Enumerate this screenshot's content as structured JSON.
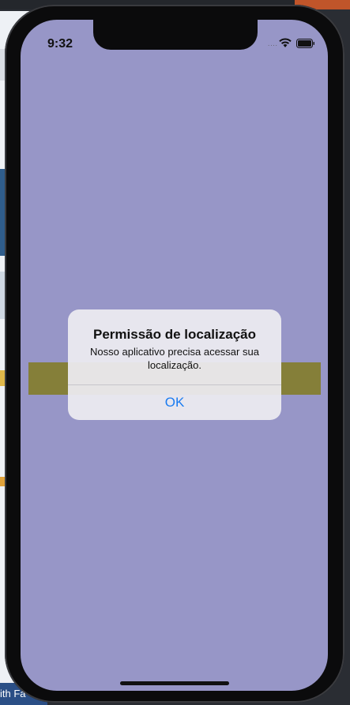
{
  "status_bar": {
    "time": "9:32",
    "signal_dots": "....",
    "icons": [
      "wifi-icon",
      "battery-icon"
    ]
  },
  "alert": {
    "title": "Permissão de localização",
    "message": "Nosso aplicativo precisa acessar sua localização.",
    "ok_label": "OK"
  },
  "background": {
    "footer_text": "ith Fa"
  },
  "colors": {
    "screen_background": "#9796c7",
    "banner": "#857f39",
    "alert_button": "#1a7bf0"
  }
}
